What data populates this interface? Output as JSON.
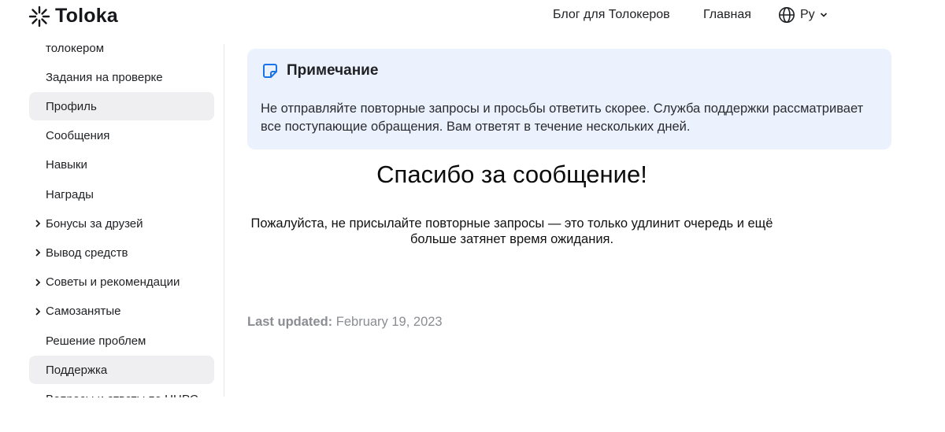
{
  "header": {
    "logo_text": "Toloka",
    "nav": {
      "blog": "Блог для Толокеров",
      "home": "Главная"
    },
    "language": "Ру"
  },
  "sidebar": {
    "items": [
      {
        "label": "толокером",
        "active": false,
        "expandable": false
      },
      {
        "label": "Задания на проверке",
        "active": false,
        "expandable": false
      },
      {
        "label": "Профиль",
        "active": true,
        "expandable": false
      },
      {
        "label": "Сообщения",
        "active": false,
        "expandable": false
      },
      {
        "label": "Навыки",
        "active": false,
        "expandable": false
      },
      {
        "label": "Награды",
        "active": false,
        "expandable": false
      },
      {
        "label": "Бонусы за друзей",
        "active": false,
        "expandable": true
      },
      {
        "label": "Вывод средств",
        "active": false,
        "expandable": true
      },
      {
        "label": "Советы и рекомендации",
        "active": false,
        "expandable": true
      },
      {
        "label": "Самозанятые",
        "active": false,
        "expandable": true
      },
      {
        "label": "Решение проблем",
        "active": false,
        "expandable": false
      },
      {
        "label": "Поддержка",
        "active": true,
        "expandable": false
      },
      {
        "label": "Вопросы и ответы по НЦРС",
        "active": false,
        "expandable": false
      }
    ]
  },
  "note": {
    "title": "Примечание",
    "body": "Не отправляйте повторные запросы и просьбы ответить скорее. Служба поддержки рассматривает все поступающие обращения. Вам ответят в течение нескольких дней."
  },
  "content": {
    "heading": "Спасибо за сообщение!",
    "text": "Пожалуйста, не присылайте повторные запросы — это только удлинит очередь и ещё больше затянет время ожидания."
  },
  "footer": {
    "updated_label": "Last updated:",
    "updated_date": "February 19, 2023"
  },
  "colors": {
    "note_background": "#ebf2fd",
    "active_item_background": "#efeff1",
    "note_icon": "#1a73e8",
    "muted_text": "#8b8d93"
  }
}
